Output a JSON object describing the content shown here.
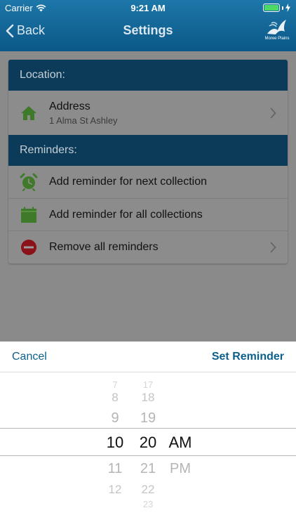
{
  "status_bar": {
    "carrier": "Carrier",
    "time": "9:21 AM"
  },
  "nav": {
    "back_label": "Back",
    "title": "Settings",
    "logo_text": "Moree Plains"
  },
  "location_section": {
    "header": "Location:",
    "address_title": "Address",
    "address_value": "1 Alma St Ashley"
  },
  "reminders_section": {
    "header": "Reminders:",
    "items": [
      {
        "label": "Add reminder for next collection",
        "icon": "alarm-clock-icon",
        "color": "#3f7a2a"
      },
      {
        "label": "Add reminder for all collections",
        "icon": "calendar-icon",
        "color": "#3f7a2a"
      },
      {
        "label": "Remove all reminders",
        "icon": "minus-circle-icon",
        "color": "#8a1218"
      }
    ]
  },
  "picker_sheet": {
    "cancel_label": "Cancel",
    "confirm_label": "Set Reminder",
    "hours": [
      "7",
      "8",
      "9",
      "10",
      "11",
      "12"
    ],
    "minutes": [
      "17",
      "18",
      "19",
      "20",
      "21",
      "22",
      "23"
    ],
    "periods": [
      "AM",
      "PM"
    ],
    "selected": {
      "hour": "10",
      "minute": "20",
      "period": "AM"
    }
  },
  "colors": {
    "nav_bar": "#0b5887",
    "section_header": "#0b3b59",
    "accent": "#0d5f8c"
  }
}
